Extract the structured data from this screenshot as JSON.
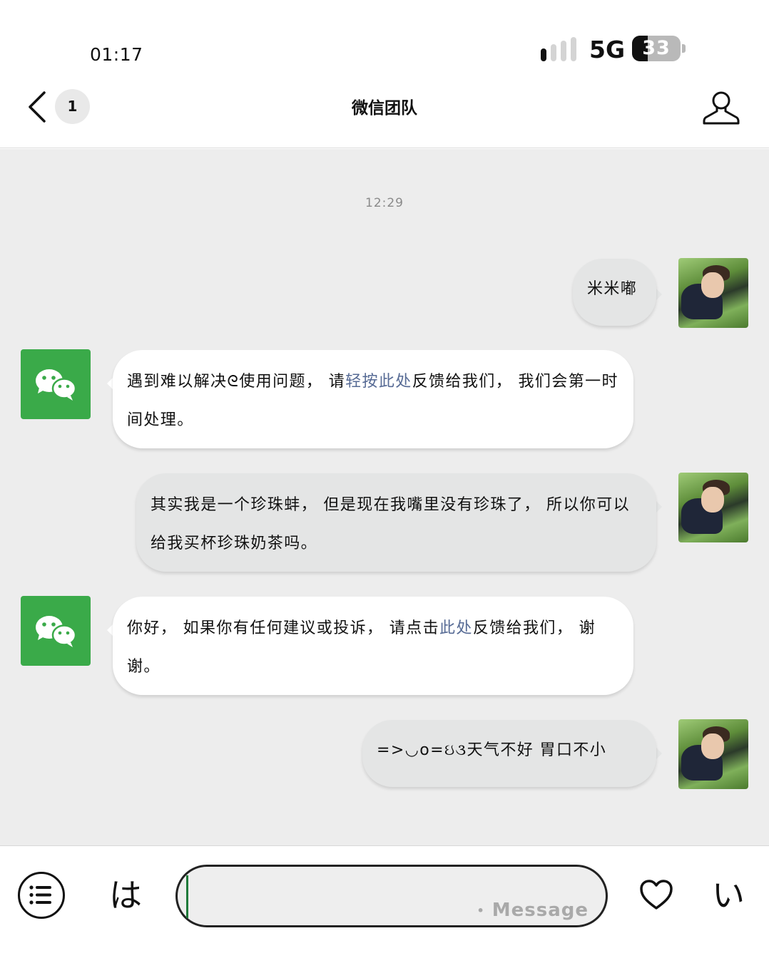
{
  "status_bar": {
    "time": "01:17",
    "network": "5G",
    "battery": "33",
    "battery_level": 0.33,
    "signal_bars_active": 1,
    "signal_bars_total": 4
  },
  "nav": {
    "unread_count": "1",
    "title": "微信团队"
  },
  "chat": {
    "timestamp": "12:29",
    "messages": [
      {
        "from": "me",
        "text": "米米嘟"
      },
      {
        "from": "them",
        "parts": [
          "遇到难以解决ᘓ使用问题， 请",
          "轻按此处",
          "反馈给我们， 我们会第一时间处理。"
        ]
      },
      {
        "from": "me",
        "text": "其实我是一个珍珠蚌， 但是现在我嘴里没有珍珠了， 所以你可以给我买杯珍珠奶茶吗。"
      },
      {
        "from": "them",
        "parts": [
          "你好， 如果你有任何建议或投诉， 请点击",
          "此处",
          "反馈给我们， 谢谢。"
        ]
      },
      {
        "from": "me",
        "text": "=>◡o=ઇ૩天气不好 胃口不小"
      }
    ]
  },
  "input_bar": {
    "left_key": "は",
    "right_key": "い",
    "placeholder": "Message",
    "placeholder_prefix": "•",
    "value": ""
  },
  "colors": {
    "chat_background": "#ededed",
    "link": "#576b95",
    "wechat_green": "#3aaa49",
    "my_bubble": "#e4e5e5",
    "their_bubble": "#ffffff"
  },
  "icons": [
    "chevron-left-icon",
    "user-icon",
    "wechat-logo-icon",
    "menu-list-icon",
    "heart-icon"
  ]
}
